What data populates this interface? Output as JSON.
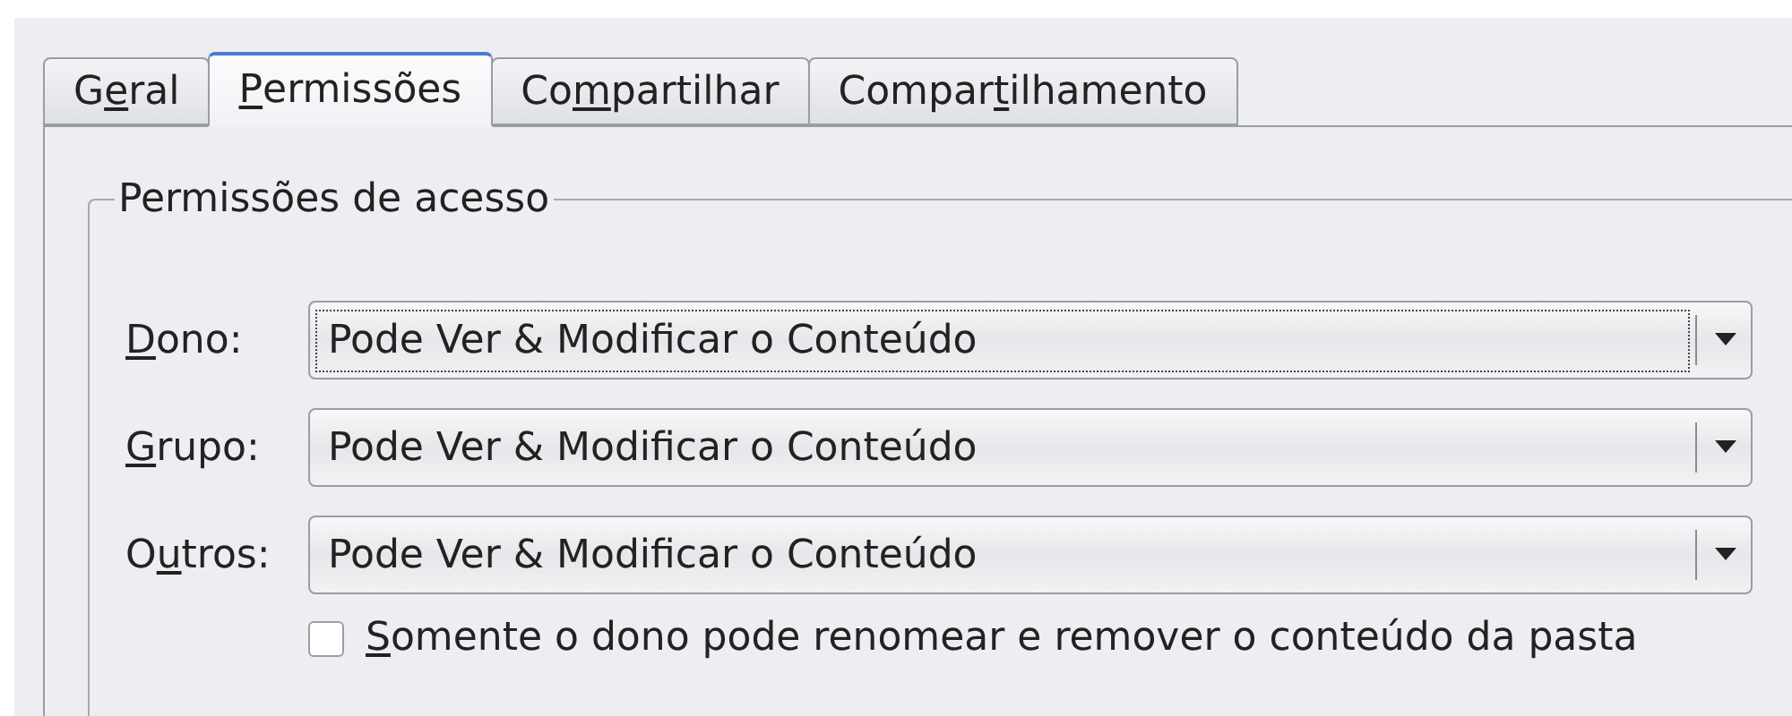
{
  "tabs": [
    {
      "before": "G",
      "key": "e",
      "after": "ral",
      "selected": false
    },
    {
      "key": "P",
      "after": "ermissões",
      "selected": true
    },
    {
      "before": "Co",
      "key": "m",
      "after": "partilhar",
      "selected": false
    },
    {
      "before": "Compar",
      "key": "t",
      "after": "ilhamento",
      "selected": false
    }
  ],
  "group": {
    "title": "Permissões de acesso",
    "rows": [
      {
        "label": {
          "key": "D",
          "after": "ono:"
        },
        "value": "Pode Ver & Modificar o Conteúdo",
        "focused": true
      },
      {
        "label": {
          "key": "G",
          "after": "rupo:"
        },
        "value": "Pode Ver & Modificar o Conteúdo",
        "focused": false
      },
      {
        "label": {
          "before": "O",
          "key": "u",
          "after": "tros:"
        },
        "value": "Pode Ver & Modificar o Conteúdo",
        "focused": false
      }
    ],
    "checkbox": {
      "label": {
        "key": "S",
        "after": "omente o dono pode renomear e remover o conteúdo da pasta"
      },
      "checked": false
    }
  }
}
